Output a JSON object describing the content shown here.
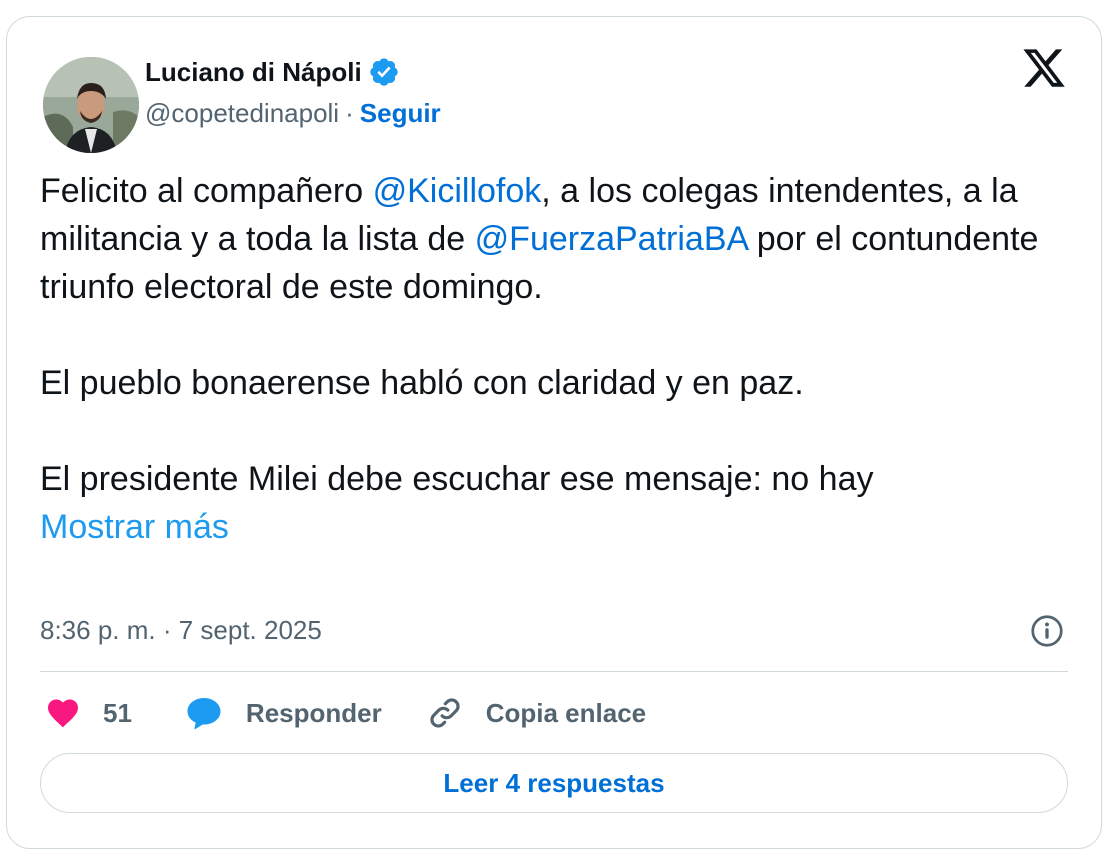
{
  "author": {
    "name": "Luciano di Nápoli",
    "handle": "@copetedinapoli",
    "separator": "·",
    "follow_label": "Seguir",
    "verified": true
  },
  "tweet": {
    "p1_pre": "Felicito al compañero ",
    "p1_mention1": "@Kicillofok",
    "p1_mid": ", a los colegas intendentes, a la militancia y a toda la lista de ",
    "p1_mention2": "@FuerzaPatriaBA",
    "p1_post": " por el contundente triunfo electoral de este domingo.",
    "p2": "El pueblo bonaerense habló con claridad y en paz.",
    "p3": "El presidente Milei debe escuchar ese mensaje: no hay",
    "show_more": "Mostrar más"
  },
  "meta": {
    "timestamp": "8:36 p. m. · 7 sept. 2025"
  },
  "actions": {
    "likes_count": "51",
    "reply_label": "Responder",
    "copy_link_label": "Copia enlace"
  },
  "read_replies_label": "Leer 4 respuestas",
  "colors": {
    "accent": "#006fd6",
    "link": "#1d9bf0",
    "like": "#f91880",
    "reply": "#1d9bf0",
    "text": "#0f1419",
    "secondary": "#536471",
    "border": "#cfd9de"
  },
  "icons": {
    "brand": "x-logo-icon",
    "verified": "verified-badge-icon",
    "info": "info-icon",
    "like": "heart-icon",
    "reply": "speech-bubble-icon",
    "copy_link": "link-icon"
  }
}
